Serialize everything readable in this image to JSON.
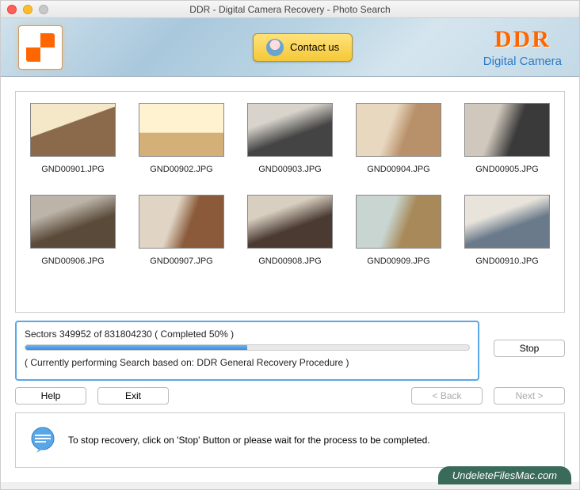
{
  "window": {
    "title": "DDR - Digital Camera Recovery - Photo Search"
  },
  "header": {
    "contact_label": "Contact us",
    "brand": "DDR",
    "brand_sub": "Digital Camera"
  },
  "thumbs": [
    {
      "file": "GND00901.JPG"
    },
    {
      "file": "GND00902.JPG"
    },
    {
      "file": "GND00903.JPG"
    },
    {
      "file": "GND00904.JPG"
    },
    {
      "file": "GND00905.JPG"
    },
    {
      "file": "GND00906.JPG"
    },
    {
      "file": "GND00907.JPG"
    },
    {
      "file": "GND00908.JPG"
    },
    {
      "file": "GND00909.JPG"
    },
    {
      "file": "GND00910.JPG"
    }
  ],
  "progress": {
    "sectors_line": "Sectors 349952 of    831804230   ( Completed 50% )",
    "percent": 50,
    "status_line": "( Currently performing Search based on: DDR General Recovery Procedure )"
  },
  "buttons": {
    "stop": "Stop",
    "help": "Help",
    "exit": "Exit",
    "back": "< Back",
    "next": "Next >"
  },
  "info": {
    "text": "To stop recovery, click on 'Stop' Button or please wait for the process to be completed."
  },
  "footer": {
    "site": "UndeleteFilesMac.com"
  }
}
